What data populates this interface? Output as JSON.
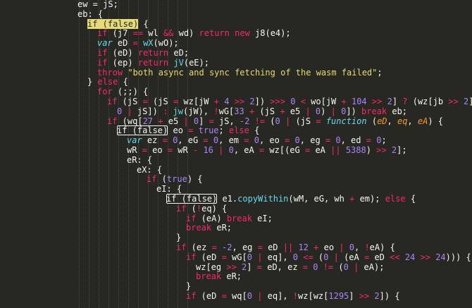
{
  "theme": {
    "background": "#272822",
    "text": "#f8f8f2",
    "keyword": "#f92672",
    "number": "#ae81ff",
    "string": "#e6db74",
    "function": "#66d9ef",
    "argument": "#fd971f"
  },
  "code_lines": [
    [
      [
        "plain",
        "ew = jS;"
      ]
    ],
    [
      [
        "plain",
        "eb: {"
      ]
    ],
    [
      [
        "cursor",
        "if (false)"
      ],
      [
        "plain",
        " {"
      ]
    ],
    [
      [
        "kw",
        "if"
      ],
      [
        "plain",
        " (j7 "
      ],
      [
        "kw",
        "=="
      ],
      [
        "plain",
        " wl "
      ],
      [
        "kw",
        "&&"
      ],
      [
        "plain",
        " wd) "
      ],
      [
        "kw",
        "return"
      ],
      [
        "plain",
        " "
      ],
      [
        "kw",
        "new"
      ],
      [
        "plain",
        " j8(e4);"
      ]
    ],
    [
      [
        "var",
        "var"
      ],
      [
        "plain",
        " eD "
      ],
      [
        "kw",
        "="
      ],
      [
        "plain",
        " "
      ],
      [
        "fn",
        "wX"
      ],
      [
        "plain",
        "(wO);"
      ]
    ],
    [
      [
        "kw",
        "if"
      ],
      [
        "plain",
        " (eD) "
      ],
      [
        "kw",
        "return"
      ],
      [
        "plain",
        " eD;"
      ]
    ],
    [
      [
        "kw",
        "if"
      ],
      [
        "plain",
        " (ep) "
      ],
      [
        "kw",
        "return"
      ],
      [
        "plain",
        " "
      ],
      [
        "fn",
        "jV"
      ],
      [
        "plain",
        "(eE);"
      ]
    ],
    [
      [
        "kw",
        "throw"
      ],
      [
        "plain",
        " "
      ],
      [
        "str",
        "\"both async and sync fetching of the wasm failed\""
      ],
      [
        "plain",
        ";"
      ]
    ],
    [
      [
        "plain",
        "} "
      ],
      [
        "kw",
        "else"
      ],
      [
        "plain",
        " {"
      ]
    ],
    [
      [
        "kw",
        "for"
      ],
      [
        "plain",
        " (;;) {"
      ]
    ],
    [
      [
        "kw",
        "if"
      ],
      [
        "plain",
        " (jS "
      ],
      [
        "kw",
        "="
      ],
      [
        "plain",
        " (jS "
      ],
      [
        "kw",
        "="
      ],
      [
        "plain",
        " wz[jW "
      ],
      [
        "kw",
        "+"
      ],
      [
        "plain",
        " "
      ],
      [
        "num",
        "4"
      ],
      [
        "plain",
        " "
      ],
      [
        "kw",
        ">>"
      ],
      [
        "plain",
        " "
      ],
      [
        "num",
        "2"
      ],
      [
        "plain",
        "]) "
      ],
      [
        "kw",
        ">>>"
      ],
      [
        "plain",
        " "
      ],
      [
        "num",
        "0"
      ],
      [
        "plain",
        " "
      ],
      [
        "kw",
        "<"
      ],
      [
        "plain",
        " wo[jW "
      ],
      [
        "kw",
        "+"
      ],
      [
        "plain",
        " "
      ],
      [
        "num",
        "104"
      ],
      [
        "plain",
        " "
      ],
      [
        "kw",
        ">>"
      ],
      [
        "plain",
        " "
      ],
      [
        "num",
        "2"
      ],
      [
        "plain",
        "] "
      ],
      [
        "kw",
        "?"
      ],
      [
        "plain",
        " (wz[jb "
      ],
      [
        "kw",
        ">>"
      ],
      [
        "plain",
        " "
      ],
      [
        "num",
        "2"
      ],
      [
        "plain",
        "] "
      ],
      [
        "kw",
        "="
      ]
    ],
    [
      [
        "num",
        "0"
      ],
      [
        "plain",
        " "
      ],
      [
        "kw",
        "|"
      ],
      [
        "plain",
        " jS]) "
      ],
      [
        "kw",
        ":"
      ],
      [
        "plain",
        " "
      ],
      [
        "fn",
        "jw"
      ],
      [
        "plain",
        "(jW), "
      ],
      [
        "kw",
        "!"
      ],
      [
        "plain",
        "wG["
      ],
      [
        "num",
        "33"
      ],
      [
        "plain",
        " "
      ],
      [
        "kw",
        "+"
      ],
      [
        "plain",
        " (jS "
      ],
      [
        "kw",
        "+"
      ],
      [
        "plain",
        " e5 "
      ],
      [
        "kw",
        "|"
      ],
      [
        "plain",
        " "
      ],
      [
        "num",
        "0"
      ],
      [
        "plain",
        ") "
      ],
      [
        "kw",
        "|"
      ],
      [
        "plain",
        " "
      ],
      [
        "num",
        "0"
      ],
      [
        "plain",
        "]) "
      ],
      [
        "kw",
        "break"
      ],
      [
        "plain",
        " eb;"
      ]
    ],
    [
      [
        "kw",
        "if"
      ],
      [
        "plain",
        " (wq["
      ],
      [
        "num",
        "27"
      ],
      [
        "plain",
        " "
      ],
      [
        "kw",
        "+"
      ],
      [
        "plain",
        " e5 "
      ],
      [
        "kw",
        "|"
      ],
      [
        "plain",
        " "
      ],
      [
        "num",
        "0"
      ],
      [
        "plain",
        "] "
      ],
      [
        "kw",
        "="
      ],
      [
        "plain",
        " jS, "
      ],
      [
        "num",
        "-2"
      ],
      [
        "plain",
        " "
      ],
      [
        "kw",
        "!="
      ],
      [
        "plain",
        " ("
      ],
      [
        "num",
        "0"
      ],
      [
        "plain",
        " "
      ],
      [
        "kw",
        "|"
      ],
      [
        "plain",
        " (jS "
      ],
      [
        "kw",
        "="
      ],
      [
        "plain",
        " "
      ],
      [
        "fx",
        "function"
      ],
      [
        "plain",
        " ("
      ],
      [
        "arg",
        "eD"
      ],
      [
        "plain",
        ", "
      ],
      [
        "arg",
        "eq"
      ],
      [
        "plain",
        ", "
      ],
      [
        "arg",
        "eA"
      ],
      [
        "plain",
        ") {"
      ]
    ],
    [
      [
        "box",
        "if (false)"
      ],
      [
        "plain",
        " eo "
      ],
      [
        "kw",
        "="
      ],
      [
        "plain",
        " "
      ],
      [
        "num",
        "true"
      ],
      [
        "plain",
        "; "
      ],
      [
        "kw",
        "else"
      ],
      [
        "plain",
        " {"
      ]
    ],
    [
      [
        "var",
        "var"
      ],
      [
        "plain",
        " ez "
      ],
      [
        "kw",
        "="
      ],
      [
        "plain",
        " "
      ],
      [
        "num",
        "0"
      ],
      [
        "plain",
        ", eG "
      ],
      [
        "kw",
        "="
      ],
      [
        "plain",
        " "
      ],
      [
        "num",
        "0"
      ],
      [
        "plain",
        ", em "
      ],
      [
        "kw",
        "="
      ],
      [
        "plain",
        " "
      ],
      [
        "num",
        "0"
      ],
      [
        "plain",
        ", eo "
      ],
      [
        "kw",
        "="
      ],
      [
        "plain",
        " "
      ],
      [
        "num",
        "0"
      ],
      [
        "plain",
        ", eg "
      ],
      [
        "kw",
        "="
      ],
      [
        "plain",
        " "
      ],
      [
        "num",
        "0"
      ],
      [
        "plain",
        ", ed "
      ],
      [
        "kw",
        "="
      ],
      [
        "plain",
        " "
      ],
      [
        "num",
        "0"
      ],
      [
        "plain",
        ";"
      ]
    ],
    [
      [
        "plain",
        "wR "
      ],
      [
        "kw",
        "="
      ],
      [
        "plain",
        " eo "
      ],
      [
        "kw",
        "="
      ],
      [
        "plain",
        " wR "
      ],
      [
        "kw",
        "-"
      ],
      [
        "plain",
        " "
      ],
      [
        "num",
        "16"
      ],
      [
        "plain",
        " "
      ],
      [
        "kw",
        "|"
      ],
      [
        "plain",
        " "
      ],
      [
        "num",
        "0"
      ],
      [
        "plain",
        ", eA "
      ],
      [
        "kw",
        "="
      ],
      [
        "plain",
        " wz[(eG "
      ],
      [
        "kw",
        "="
      ],
      [
        "plain",
        " eA "
      ],
      [
        "kw",
        "||"
      ],
      [
        "plain",
        " "
      ],
      [
        "num",
        "5388"
      ],
      [
        "plain",
        ") "
      ],
      [
        "kw",
        ">>"
      ],
      [
        "plain",
        " "
      ],
      [
        "num",
        "2"
      ],
      [
        "plain",
        "];"
      ]
    ],
    [
      [
        "plain",
        "eR: {"
      ]
    ],
    [
      [
        "plain",
        "eX: {"
      ]
    ],
    [
      [
        "kw",
        "if"
      ],
      [
        "plain",
        " ("
      ],
      [
        "num",
        "true"
      ],
      [
        "plain",
        ") {"
      ]
    ],
    [
      [
        "plain",
        "eI: {"
      ]
    ],
    [
      [
        "box",
        "if (false)"
      ],
      [
        "plain",
        " e1."
      ],
      [
        "fn",
        "copyWithin"
      ],
      [
        "plain",
        "(wM, eG, wh "
      ],
      [
        "kw",
        "+"
      ],
      [
        "plain",
        " em); "
      ],
      [
        "kw",
        "else"
      ],
      [
        "plain",
        " {"
      ]
    ],
    [
      [
        "kw",
        "if"
      ],
      [
        "plain",
        " ("
      ],
      [
        "kw",
        "!"
      ],
      [
        "plain",
        "eq) {"
      ]
    ],
    [
      [
        "kw",
        "if"
      ],
      [
        "plain",
        " (eA) "
      ],
      [
        "kw",
        "break"
      ],
      [
        "plain",
        " eI;"
      ]
    ],
    [
      [
        "kw",
        "break"
      ],
      [
        "plain",
        " eR;"
      ]
    ],
    [
      [
        "plain",
        "}"
      ]
    ],
    [
      [
        "kw",
        "if"
      ],
      [
        "plain",
        " (ez "
      ],
      [
        "kw",
        "="
      ],
      [
        "plain",
        " "
      ],
      [
        "num",
        "-2"
      ],
      [
        "plain",
        ", eg "
      ],
      [
        "kw",
        "="
      ],
      [
        "plain",
        " eD "
      ],
      [
        "kw",
        "||"
      ],
      [
        "plain",
        " "
      ],
      [
        "num",
        "12"
      ],
      [
        "plain",
        " "
      ],
      [
        "kw",
        "+"
      ],
      [
        "plain",
        " eo "
      ],
      [
        "kw",
        "|"
      ],
      [
        "plain",
        " "
      ],
      [
        "num",
        "0"
      ],
      [
        "plain",
        ", "
      ],
      [
        "kw",
        "!"
      ],
      [
        "plain",
        "eA) {"
      ]
    ],
    [
      [
        "kw",
        "if"
      ],
      [
        "plain",
        " (eD "
      ],
      [
        "kw",
        "="
      ],
      [
        "plain",
        " wG["
      ],
      [
        "num",
        "0"
      ],
      [
        "plain",
        " "
      ],
      [
        "kw",
        "|"
      ],
      [
        "plain",
        " eq], "
      ],
      [
        "num",
        "0"
      ],
      [
        "plain",
        " "
      ],
      [
        "kw",
        "<="
      ],
      [
        "plain",
        " ("
      ],
      [
        "num",
        "0"
      ],
      [
        "plain",
        " "
      ],
      [
        "kw",
        "|"
      ],
      [
        "plain",
        " (eA "
      ],
      [
        "kw",
        "="
      ],
      [
        "plain",
        " eD "
      ],
      [
        "kw",
        "<<"
      ],
      [
        "plain",
        " "
      ],
      [
        "num",
        "24"
      ],
      [
        "plain",
        " "
      ],
      [
        "kw",
        ">>"
      ],
      [
        "plain",
        " "
      ],
      [
        "num",
        "24"
      ],
      [
        "plain",
        "))) {"
      ]
    ],
    [
      [
        "plain",
        "wz[eg "
      ],
      [
        "kw",
        ">>"
      ],
      [
        "plain",
        " "
      ],
      [
        "num",
        "2"
      ],
      [
        "plain",
        "] "
      ],
      [
        "kw",
        "="
      ],
      [
        "plain",
        " eD, ez "
      ],
      [
        "kw",
        "="
      ],
      [
        "plain",
        " "
      ],
      [
        "num",
        "0"
      ],
      [
        "plain",
        " "
      ],
      [
        "kw",
        "!="
      ],
      [
        "plain",
        " ("
      ],
      [
        "num",
        "0"
      ],
      [
        "plain",
        " "
      ],
      [
        "kw",
        "|"
      ],
      [
        "plain",
        " eA);"
      ]
    ],
    [
      [
        "kw",
        "break"
      ],
      [
        "plain",
        " eR;"
      ]
    ],
    [
      [
        "plain",
        "}"
      ]
    ],
    [
      [
        "kw",
        "if"
      ],
      [
        "plain",
        " (eD "
      ],
      [
        "kw",
        "="
      ],
      [
        "plain",
        " wq["
      ],
      [
        "num",
        "0"
      ],
      [
        "plain",
        " "
      ],
      [
        "kw",
        "|"
      ],
      [
        "plain",
        " eq], "
      ],
      [
        "kw",
        "!"
      ],
      [
        "plain",
        "wz[wz["
      ],
      [
        "num",
        "1295"
      ],
      [
        "plain",
        "] "
      ],
      [
        "kw",
        ">>"
      ],
      [
        "plain",
        " "
      ],
      [
        "num",
        "2"
      ],
      [
        "plain",
        "]) {"
      ]
    ]
  ]
}
